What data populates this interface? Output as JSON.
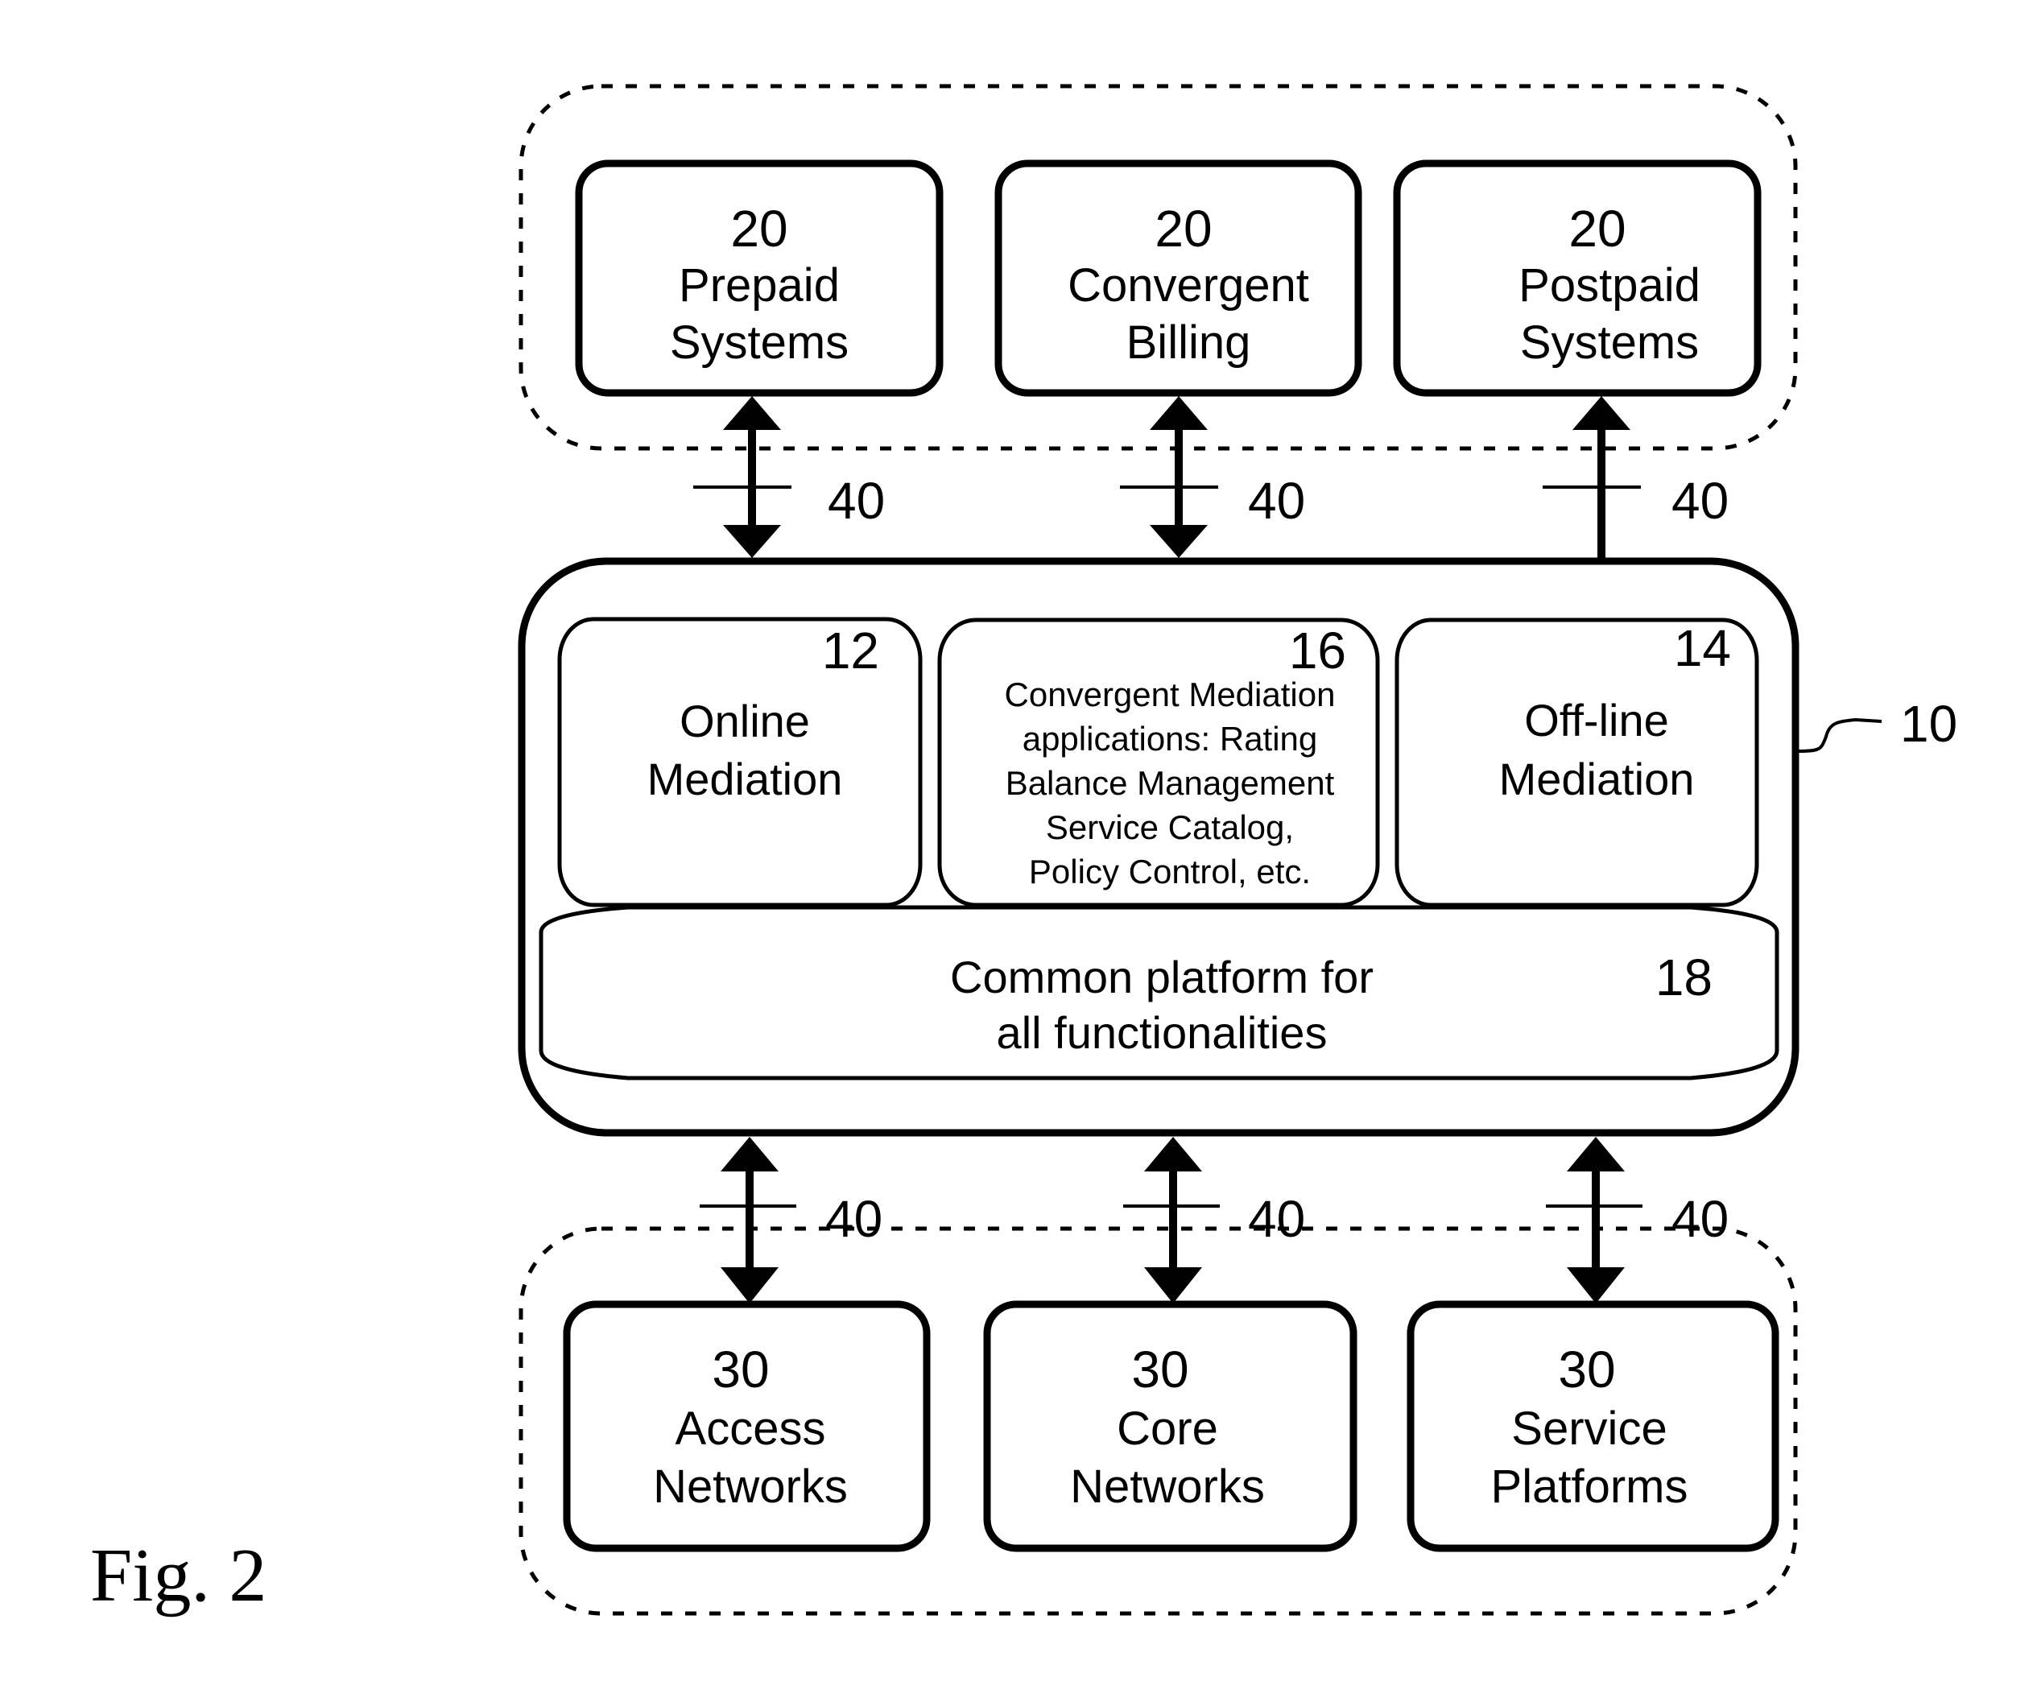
{
  "figure": {
    "caption": "Fig. 2",
    "main_system": {
      "ref": "10",
      "modules": [
        {
          "ref": "12",
          "lines": [
            "Online",
            "Mediation"
          ]
        },
        {
          "ref": "16",
          "lines": [
            "Convergent Mediation",
            "applications: Rating",
            "Balance Management",
            "Service Catalog,",
            "Policy Control, etc."
          ]
        },
        {
          "ref": "14",
          "lines": [
            "Off-line",
            "Mediation"
          ]
        }
      ],
      "platform": {
        "ref": "18",
        "lines": [
          "Common platform for",
          "all functionalities"
        ]
      }
    },
    "upper_systems": [
      {
        "ref": "20",
        "lines": [
          "Prepaid",
          "Systems"
        ]
      },
      {
        "ref": "20",
        "lines": [
          "Convergent",
          "Billing"
        ]
      },
      {
        "ref": "20",
        "lines": [
          "Postpaid",
          "Systems"
        ]
      }
    ],
    "lower_systems": [
      {
        "ref": "30",
        "lines": [
          "Access",
          "Networks"
        ]
      },
      {
        "ref": "30",
        "lines": [
          "Core",
          "Networks"
        ]
      },
      {
        "ref": "30",
        "lines": [
          "Service",
          "Platforms"
        ]
      }
    ],
    "interfaces": {
      "upper": [
        {
          "ref": "40",
          "direction": "bidirectional"
        },
        {
          "ref": "40",
          "direction": "bidirectional"
        },
        {
          "ref": "40",
          "direction": "up"
        }
      ],
      "lower": [
        {
          "ref": "40",
          "direction": "bidirectional"
        },
        {
          "ref": "40",
          "direction": "bidirectional"
        },
        {
          "ref": "40",
          "direction": "bidirectional"
        }
      ]
    }
  }
}
